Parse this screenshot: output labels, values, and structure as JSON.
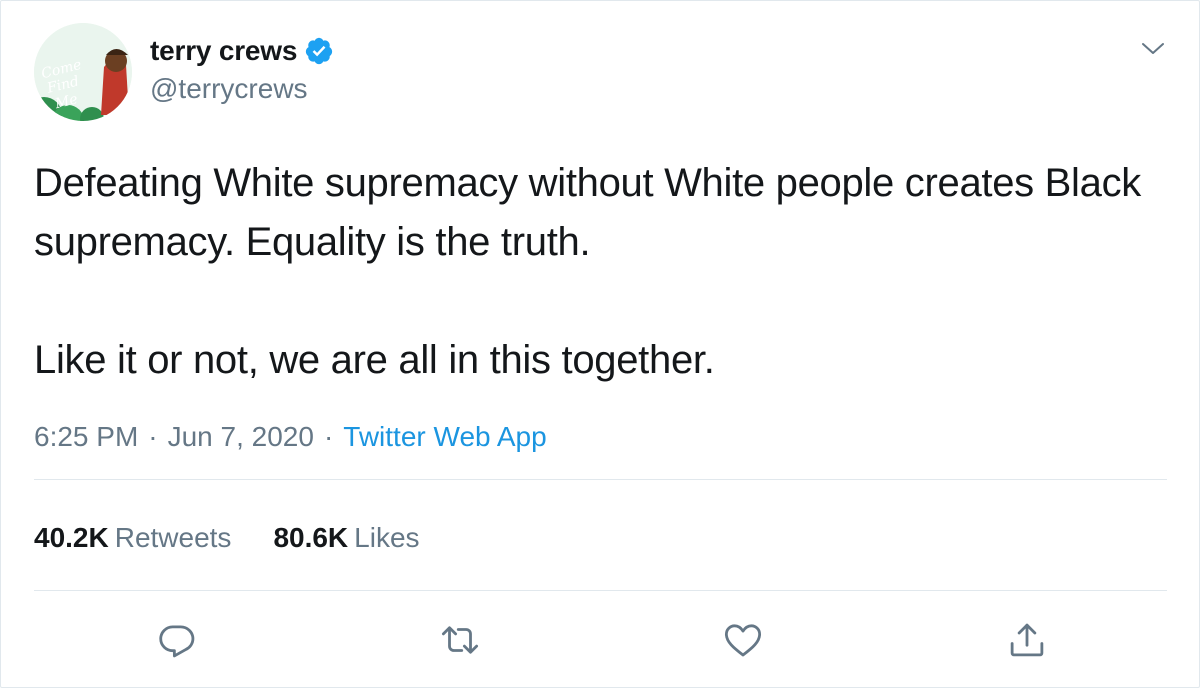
{
  "author": {
    "display_name": "terry crews",
    "handle": "@terrycrews",
    "verified": true,
    "avatar_icon": "profile-photo",
    "avatar_text": "Come Find Me"
  },
  "tweet": {
    "paragraphs": [
      "Defeating White supremacy without White people creates Black supremacy. Equality is the truth.",
      "Like it or not, we are all in this together."
    ],
    "time": "6:25 PM",
    "date": "Jun 7, 2020",
    "separator": "·",
    "source": "Twitter Web App"
  },
  "stats": {
    "retweets_count": "40.2K",
    "retweets_label": "Retweets",
    "likes_count": "80.6K",
    "likes_label": "Likes"
  },
  "actions": {
    "reply_icon": "reply-icon",
    "retweet_icon": "retweet-icon",
    "like_icon": "heart-icon",
    "share_icon": "share-icon",
    "more_icon": "chevron-down-icon"
  },
  "colors": {
    "text": "#14171a",
    "secondary": "#657786",
    "link": "#1b95e0",
    "verified": "#1da1f2",
    "divider": "#e1e8ed"
  }
}
